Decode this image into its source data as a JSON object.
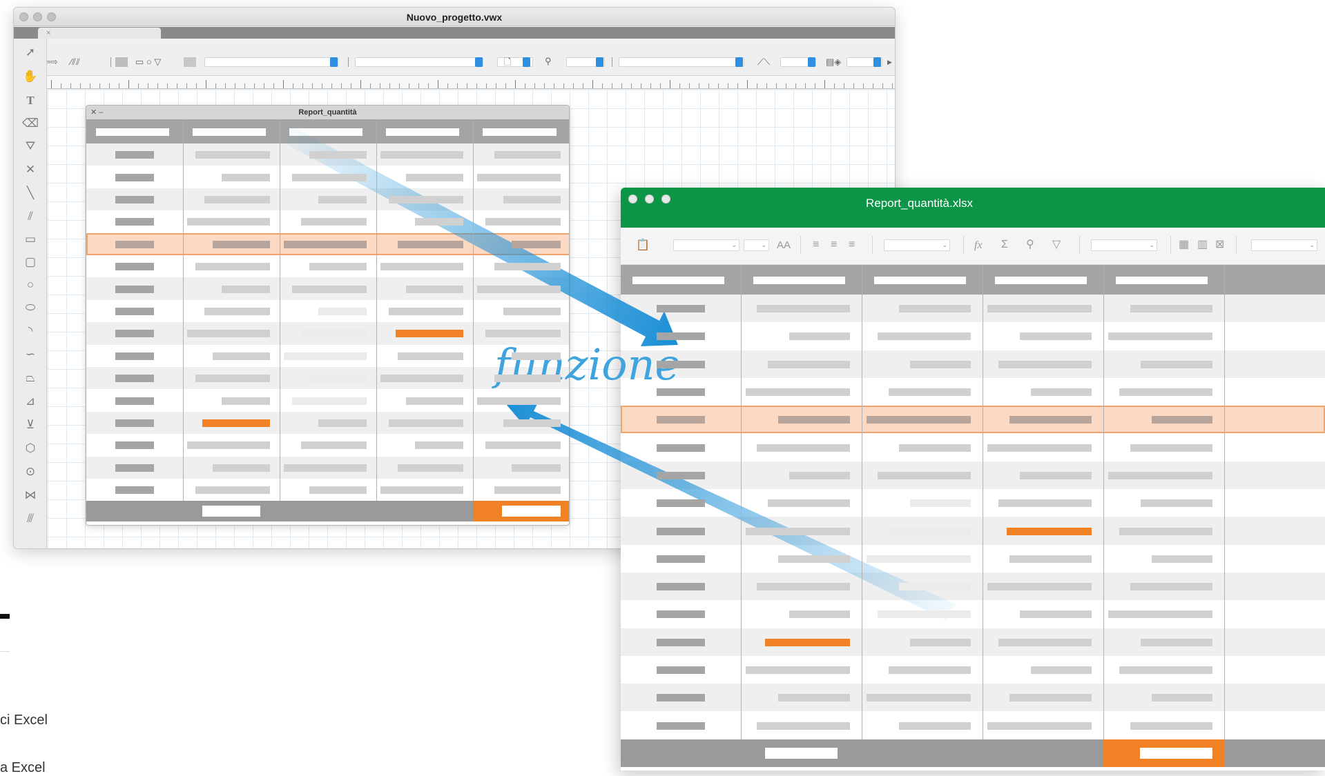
{
  "vectorworks": {
    "window_title": "Nuovo_progetto.vwx",
    "tab_close": "×",
    "worksheet_title": "Report_quantità",
    "worksheet_controls": "✕ –"
  },
  "excel": {
    "window_title": "Report_quantità.xlsx",
    "font_size_glyph": "AA"
  },
  "overlay": {
    "label": "funzione",
    "arrow_color": "#1b8fd6"
  },
  "page": {
    "fragment_1": "ci Excel",
    "fragment_2": "a Excel"
  },
  "colors": {
    "excel_green": "#0d9547",
    "highlight_row": "#fbd9c2",
    "highlight_border": "#f1a46a",
    "accent_orange": "#f08124",
    "header_grey": "#a4a4a4"
  },
  "icons": {
    "vw_tools": [
      "arrow-cursor-icon",
      "hand-pan-icon",
      "text-tool-icon",
      "eraser-icon",
      "paint-bucket-icon",
      "x-constraint-icon",
      "line-icon",
      "double-line-icon",
      "rectangle-icon",
      "rounded-rectangle-icon",
      "circle-icon",
      "oval-icon",
      "arc-icon",
      "freehand-icon",
      "polygon-icon",
      "polyline-icon",
      "freeform-icon",
      "regular-polygon-icon",
      "spiral-icon",
      "mirror-icon",
      "hatch-icon"
    ],
    "excel_toolbar": [
      "paste-icon",
      "font-size-icon",
      "align-left-icon",
      "align-center-icon",
      "align-right-icon",
      "function-icon",
      "autosum-icon",
      "find-icon",
      "filter-icon",
      "table-style-icon",
      "column-icon",
      "borders-icon"
    ]
  }
}
